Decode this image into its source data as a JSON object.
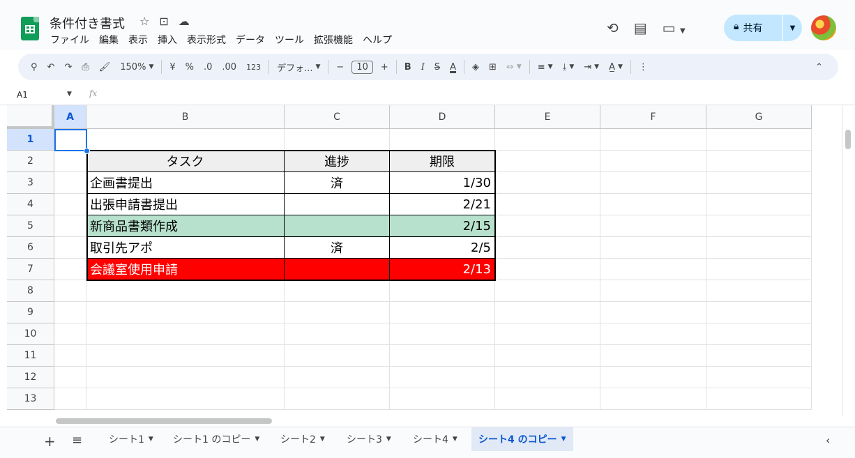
{
  "title_bar": {
    "doc_title": "条件付き書式",
    "star_icon": "star-icon",
    "move_icon": "folder-move-icon",
    "cloud_icon": "cloud-status-icon"
  },
  "menu": [
    "ファイル",
    "編集",
    "表示",
    "挿入",
    "表示形式",
    "データ",
    "ツール",
    "拡張機能",
    "ヘルプ"
  ],
  "header_actions": {
    "history_icon": "history-icon",
    "comment_icon": "comment-icon",
    "meet_icon": "video-call-icon",
    "share_label": "共有",
    "share_icon": "lock-icon"
  },
  "toolbar": {
    "zoom": "150%",
    "currency": "¥",
    "percent": "%",
    "dec_less": ".0",
    "dec_more": ".00",
    "format_123": "123",
    "font": "デフォ...",
    "font_size": "10",
    "bold": "B",
    "italic": "I",
    "strike": "S",
    "text_color": "A",
    "minus": "−",
    "plus": "+"
  },
  "formula_bar": {
    "name_box": "A1",
    "fx": "fx",
    "content": ""
  },
  "columns": [
    "A",
    "B",
    "C",
    "D",
    "E",
    "F",
    "G"
  ],
  "rows": [
    "1",
    "2",
    "3",
    "4",
    "5",
    "6",
    "7",
    "8",
    "9",
    "10",
    "11",
    "12",
    "13"
  ],
  "table": {
    "headers": [
      "タスク",
      "進捗",
      "期限"
    ],
    "rows": [
      {
        "task": "企画書提出",
        "progress": "済",
        "due": "1/30",
        "style": "plain"
      },
      {
        "task": "出張申請書提出",
        "progress": "",
        "due": "2/21",
        "style": "plain"
      },
      {
        "task": "新商品書類作成",
        "progress": "",
        "due": "2/15",
        "style": "green"
      },
      {
        "task": "取引先アポ",
        "progress": "済",
        "due": "2/5",
        "style": "plain"
      },
      {
        "task": "会議室使用申請",
        "progress": "",
        "due": "2/13",
        "style": "red"
      }
    ]
  },
  "colors": {
    "header_fill": "#efefef",
    "green_fill": "#b7e1cd",
    "red_fill": "#ff0000",
    "selection": "#1a73e8",
    "share_bg": "#c2e7ff"
  },
  "sheet_tabs": [
    {
      "label": "シート1",
      "active": false
    },
    {
      "label": "シート1 のコピー",
      "active": false
    },
    {
      "label": "シート2",
      "active": false
    },
    {
      "label": "シート3",
      "active": false
    },
    {
      "label": "シート4",
      "active": false
    },
    {
      "label": "シート4 のコピー",
      "active": true
    }
  ]
}
